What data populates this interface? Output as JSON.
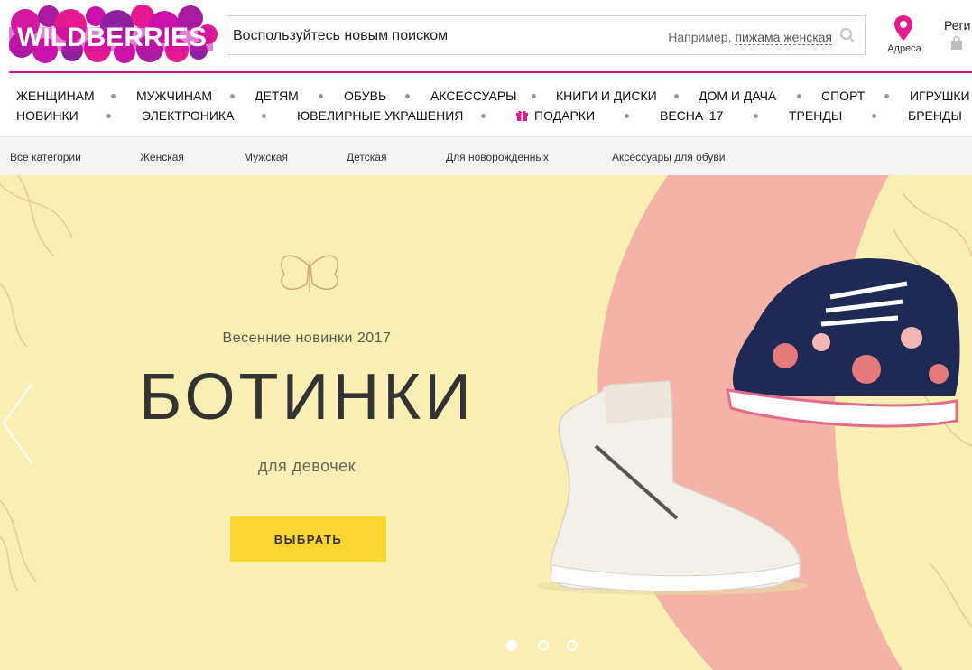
{
  "header": {
    "logo_text": "WILDBERRIES",
    "search": {
      "value": "Воспользуйтесь новым поиском",
      "hint_prefix": "Например,",
      "hint_example": "пижама женская"
    },
    "address_label": "Адреса",
    "region_label": "Реги",
    "colors": {
      "brand": "#cb11ab",
      "pin": "#e5188e"
    }
  },
  "main_menu": {
    "row1": [
      "ЖЕНЩИНАМ",
      "МУЖЧИНАМ",
      "ДЕТЯМ",
      "ОБУВЬ",
      "АКСЕССУАРЫ",
      "КНИГИ И ДИСКИ",
      "ДОМ И ДАЧА",
      "СПОРТ",
      "ИГРУШКИ"
    ],
    "row2": [
      "НОВИНКИ",
      "ЭЛЕКТРОНИКА",
      "ЮВЕЛИРНЫЕ УКРАШЕНИЯ",
      "ПОДАРКИ",
      "ВЕСНА '17",
      "ТРЕНДЫ",
      "БРЕНДЫ"
    ]
  },
  "categories": [
    "Все категории",
    "Женская",
    "Мужская",
    "Детская",
    "Для новорожденных",
    "Аксессуары для обуви"
  ],
  "banner": {
    "subtitle": "Весенние новинки 2017",
    "title": "БОТИНКИ",
    "caption": "для девочек",
    "cta_label": "ВЫБРАТЬ",
    "slides_total": 3,
    "active_slide": 1,
    "colors": {
      "background": "#fbefb4",
      "arc": "#f5b3a8",
      "cta": "#fbd632"
    }
  }
}
